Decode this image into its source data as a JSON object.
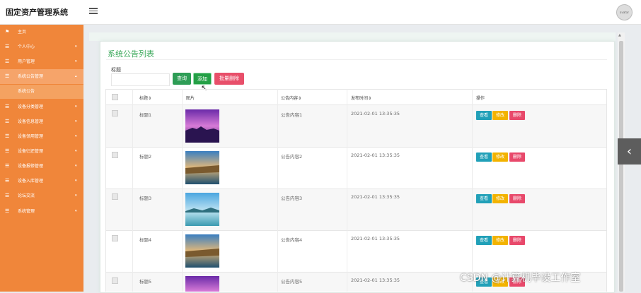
{
  "app": {
    "title": "固定资产管理系统",
    "avatar_text": "avatar"
  },
  "sidebar": {
    "items": [
      {
        "label": "主页",
        "icon": "flag-icon"
      },
      {
        "label": "个人中心",
        "icon": "list-icon"
      },
      {
        "label": "用户管理",
        "icon": "list-icon"
      },
      {
        "label": "系统公告管理",
        "icon": "list-icon"
      },
      {
        "label": "设备分类管理",
        "icon": "list-icon"
      },
      {
        "label": "设备信息管理",
        "icon": "list-icon"
      },
      {
        "label": "设备领用管理",
        "icon": "list-icon"
      },
      {
        "label": "设备归还管理",
        "icon": "list-icon"
      },
      {
        "label": "设备报修管理",
        "icon": "list-icon"
      },
      {
        "label": "设备入库管理",
        "icon": "list-icon"
      },
      {
        "label": "论坛交流",
        "icon": "list-icon"
      },
      {
        "label": "系统管理",
        "icon": "list-icon"
      }
    ],
    "sub_item": {
      "label": "系统公告"
    }
  },
  "main": {
    "title": "系统公告列表",
    "search_label": "标题",
    "search_value": "",
    "buttons": {
      "search": "查询",
      "add": "添加",
      "batch_delete": "批量删除"
    },
    "columns": [
      "",
      "标题",
      "图片",
      "公告内容",
      "发布时间",
      "操作"
    ],
    "rows": [
      {
        "title": "标题1",
        "content": "公告内容1",
        "time": "2021-02-01 13:35:35"
      },
      {
        "title": "标题2",
        "content": "公告内容2",
        "time": "2021-02-01 13:35:35"
      },
      {
        "title": "标题3",
        "content": "公告内容3",
        "time": "2021-02-01 13:35:35"
      },
      {
        "title": "标题4",
        "content": "公告内容4",
        "time": "2021-02-01 13:35:35"
      },
      {
        "title": "标题5",
        "content": "公告内容5",
        "time": "2021-02-01 13:35:35"
      }
    ],
    "row_actions": {
      "view": "查看",
      "edit": "修改",
      "delete": "删除"
    }
  },
  "watermark": "CSDN @计算机毕设工作室",
  "colors": {
    "sidebar": "#f0863a",
    "accent_green": "#3aa85a",
    "view": "#21a0b8",
    "edit": "#f2b300",
    "delete": "#e8496b"
  }
}
